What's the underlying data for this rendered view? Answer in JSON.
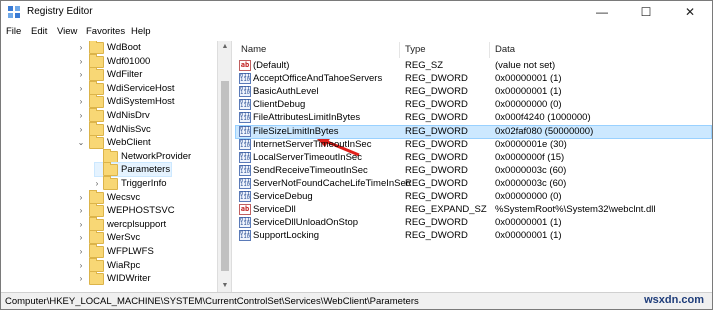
{
  "window": {
    "title": "Registry Editor",
    "minimize_glyph": "—",
    "maximize_glyph": "☐",
    "close_glyph": "✕"
  },
  "menu": [
    "File",
    "Edit",
    "View",
    "Favorites",
    "Help"
  ],
  "tree": {
    "items": [
      {
        "label": "WdBoot",
        "expander": "›",
        "selected": false,
        "level": 0
      },
      {
        "label": "Wdf01000",
        "expander": "›",
        "selected": false,
        "level": 0
      },
      {
        "label": "WdFilter",
        "expander": "›",
        "selected": false,
        "level": 0
      },
      {
        "label": "WdiServiceHost",
        "expander": "›",
        "selected": false,
        "level": 0
      },
      {
        "label": "WdiSystemHost",
        "expander": "›",
        "selected": false,
        "level": 0
      },
      {
        "label": "WdNisDrv",
        "expander": "›",
        "selected": false,
        "level": 0
      },
      {
        "label": "WdNisSvc",
        "expander": "›",
        "selected": false,
        "level": 0
      },
      {
        "label": "WebClient",
        "expander": "⌄",
        "selected": false,
        "level": 0
      },
      {
        "label": "NetworkProvider",
        "expander": "",
        "selected": false,
        "level": 1
      },
      {
        "label": "Parameters",
        "expander": "",
        "selected": true,
        "level": 1
      },
      {
        "label": "TriggerInfo",
        "expander": "›",
        "selected": false,
        "level": 1
      },
      {
        "label": "Wecsvc",
        "expander": "›",
        "selected": false,
        "level": 0
      },
      {
        "label": "WEPHOSTSVC",
        "expander": "›",
        "selected": false,
        "level": 0
      },
      {
        "label": "wercplsupport",
        "expander": "›",
        "selected": false,
        "level": 0
      },
      {
        "label": "WerSvc",
        "expander": "›",
        "selected": false,
        "level": 0
      },
      {
        "label": "WFPLWFS",
        "expander": "›",
        "selected": false,
        "level": 0
      },
      {
        "label": "WiaRpc",
        "expander": "›",
        "selected": false,
        "level": 0
      },
      {
        "label": "WIDWriter",
        "expander": "›",
        "selected": false,
        "level": 0
      }
    ]
  },
  "list": {
    "columns": [
      "Name",
      "Type",
      "Data"
    ],
    "rows": [
      {
        "icon": "ab",
        "name": "(Default)",
        "type": "REG_SZ",
        "data": "(value not set)",
        "selected": false
      },
      {
        "icon": "dword",
        "name": "AcceptOfficeAndTahoeServers",
        "type": "REG_DWORD",
        "data": "0x00000001 (1)",
        "selected": false
      },
      {
        "icon": "dword",
        "name": "BasicAuthLevel",
        "type": "REG_DWORD",
        "data": "0x00000001 (1)",
        "selected": false
      },
      {
        "icon": "dword",
        "name": "ClientDebug",
        "type": "REG_DWORD",
        "data": "0x00000000 (0)",
        "selected": false
      },
      {
        "icon": "dword",
        "name": "FileAttributesLimitInBytes",
        "type": "REG_DWORD",
        "data": "0x000f4240 (1000000)",
        "selected": false
      },
      {
        "icon": "dword",
        "name": "FileSizeLimitInBytes",
        "type": "REG_DWORD",
        "data": "0x02faf080 (50000000)",
        "selected": true
      },
      {
        "icon": "dword",
        "name": "InternetServerTimeoutInSec",
        "type": "REG_DWORD",
        "data": "0x0000001e (30)",
        "selected": false
      },
      {
        "icon": "dword",
        "name": "LocalServerTimeoutInSec",
        "type": "REG_DWORD",
        "data": "0x0000000f (15)",
        "selected": false
      },
      {
        "icon": "dword",
        "name": "SendReceiveTimeoutInSec",
        "type": "REG_DWORD",
        "data": "0x0000003c (60)",
        "selected": false
      },
      {
        "icon": "dword",
        "name": "ServerNotFoundCacheLifeTimeInSec",
        "type": "REG_DWORD",
        "data": "0x0000003c (60)",
        "selected": false
      },
      {
        "icon": "dword",
        "name": "ServiceDebug",
        "type": "REG_DWORD",
        "data": "0x00000000 (0)",
        "selected": false
      },
      {
        "icon": "ab",
        "name": "ServiceDll",
        "type": "REG_EXPAND_SZ",
        "data": "%SystemRoot%\\System32\\webclnt.dll",
        "selected": false
      },
      {
        "icon": "dword",
        "name": "ServiceDllUnloadOnStop",
        "type": "REG_DWORD",
        "data": "0x00000001 (1)",
        "selected": false
      },
      {
        "icon": "dword",
        "name": "SupportLocking",
        "type": "REG_DWORD",
        "data": "0x00000001 (1)",
        "selected": false
      }
    ]
  },
  "status_bar": {
    "path": "Computer\\HKEY_LOCAL_MACHINE\\SYSTEM\\CurrentControlSet\\Services\\WebClient\\Parameters"
  },
  "watermark": "wsxdn.com",
  "colors": {
    "selection": "#cce8ff",
    "folder": "#f8d775",
    "annotation_arrow": "#e0201b"
  }
}
